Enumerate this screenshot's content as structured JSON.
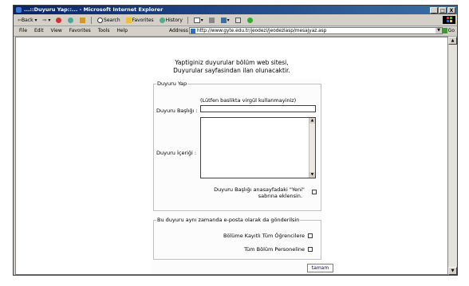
{
  "window": {
    "title": "...::Duyuru Yap::... - Microsoft Internet Explorer",
    "buttons": [
      "_",
      "□",
      "X"
    ]
  },
  "toolbar": {
    "back": "Back",
    "search": "Search",
    "favorites": "Favorites",
    "history": "History"
  },
  "menu": [
    "File",
    "Edit",
    "View",
    "Favorites",
    "Tools",
    "Help"
  ],
  "address": {
    "label": "Address",
    "url": "http://www.gyte.edu.tr/jeodezi/jeodezlasp/mesajyaz.asp",
    "go": "Go"
  },
  "page": {
    "intro_line1": "Yaptiginiz duyurular bölüm web sitesi,",
    "intro_line2": "Duyurular sayfasindan ilan olunacaktir.",
    "form": {
      "legend": "Duyuru Yap",
      "hint": "(Lütfen baslikta virgül kullanmayiniz)",
      "title_label": "Duyuru Başlığı :",
      "title_value": "",
      "content_label": "Duyuru İçeriği :",
      "content_value": "",
      "home_check_line1": "Duyuru Başlığı anasayfadaki \"Yeni\"",
      "home_check_line2": "sabrına eklensin.",
      "home_checked": false
    },
    "email": {
      "legend": "Bu duyuru aynı zamanda e-posta olarak da gönderilsin",
      "students_label": "Bölüme Kayıtlı Tüm Öğrencilere",
      "students_checked": false,
      "staff_label": "Tüm Bölüm Personeline",
      "staff_checked": false
    },
    "submit_label": "tamam"
  },
  "colors": {
    "titlebar_start": "#0a246a",
    "titlebar_end": "#3a6ea5",
    "chrome": "#d4d0c8",
    "link": "#000080"
  }
}
